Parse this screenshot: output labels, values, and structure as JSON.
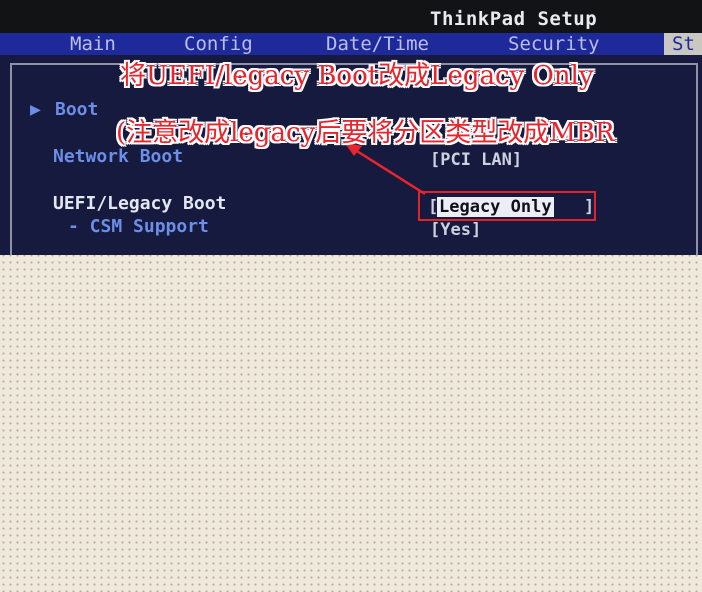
{
  "window": {
    "title": "ThinkPad Setup"
  },
  "menu": {
    "items": [
      {
        "label": "Main"
      },
      {
        "label": "Config"
      },
      {
        "label": "Date/Time"
      },
      {
        "label": "Security"
      },
      {
        "label": "St"
      }
    ]
  },
  "settings": {
    "boot_label": "Boot",
    "network_boot": {
      "label": "Network Boot",
      "value": "[PCI LAN]"
    },
    "uefi_legacy_boot": {
      "label": "UEFI/Legacy Boot",
      "value_left_bracket": "[",
      "value": "Legacy Only",
      "value_right_bracket": "]"
    },
    "csm_support": {
      "label": "- CSM Support",
      "value": "[Yes]"
    }
  },
  "annotations": {
    "line1": "将UEFI/legacy Boot改成Legacy Only",
    "line2": "(注意改成legacy后要将分区类型改成MBR"
  },
  "colors": {
    "menu_bar": "#1f2a9a",
    "panel_bg": "#151a3e",
    "label_blue": "#6d8ee8",
    "annotation_red": "#e8242c"
  }
}
